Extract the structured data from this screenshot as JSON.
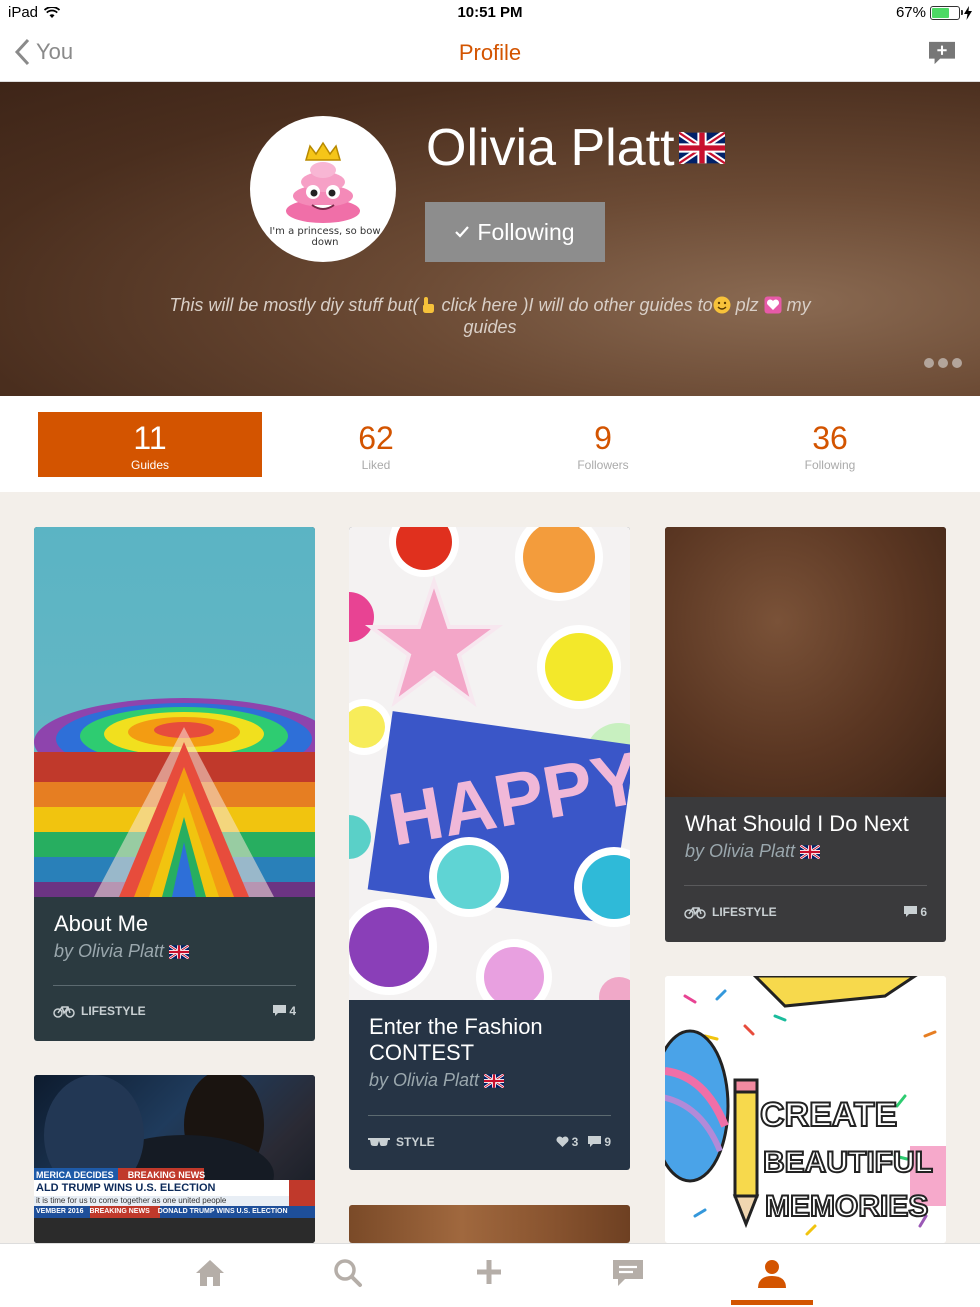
{
  "status_bar": {
    "device": "iPad",
    "time": "10:51 PM",
    "battery": "67%",
    "battery_level": 0.67
  },
  "nav": {
    "back_label": "You",
    "title": "Profile"
  },
  "profile": {
    "name": "Olivia Platt",
    "follow_label": "Following",
    "avatar_caption": "I'm a princess, so bow down",
    "bio_part1": "This will be mostly diy stuff but(",
    "bio_part2": " click here )I will do other guides to",
    "bio_part3": " plz ",
    "bio_part4": " my guides"
  },
  "stats": [
    {
      "value": "11",
      "label": "Guides"
    },
    {
      "value": "62",
      "label": "Liked"
    },
    {
      "value": "9",
      "label": "Followers"
    },
    {
      "value": "36",
      "label": "Following"
    }
  ],
  "cards": {
    "about": {
      "title": "About Me",
      "author": "by Olivia Platt",
      "category": "LIFESTYLE",
      "comments": "4"
    },
    "fashion": {
      "title": "Enter the Fashion CONTEST",
      "author": "by Olivia Platt",
      "category": "STYLE",
      "likes": "3",
      "comments": "9"
    },
    "next": {
      "title": "What Should I Do Next",
      "author": "by Olivia Platt",
      "category": "LIFESTYLE",
      "comments": "6"
    },
    "happy_text": "HAPPY",
    "memories_text": [
      "CREATE",
      "BEAUTIFUL",
      "MEMORIES"
    ],
    "news": {
      "line1": "MERICA DECIDES",
      "line1b": "BREAKING NEWS",
      "line2": "ALD TRUMP WINS U.S. ELECTION",
      "line3": "it is time for us to come together as one united people",
      "line4": "VEMBER 2016",
      "line4b": "BREAKING NEWS",
      "line4c": "DONALD TRUMP WINS U.S. ELECTION"
    }
  },
  "colors": {
    "accent": "#d35400",
    "card_dark": "#2b3a40",
    "card_navy": "#263445",
    "follow_bg": "#8d8d8d"
  }
}
